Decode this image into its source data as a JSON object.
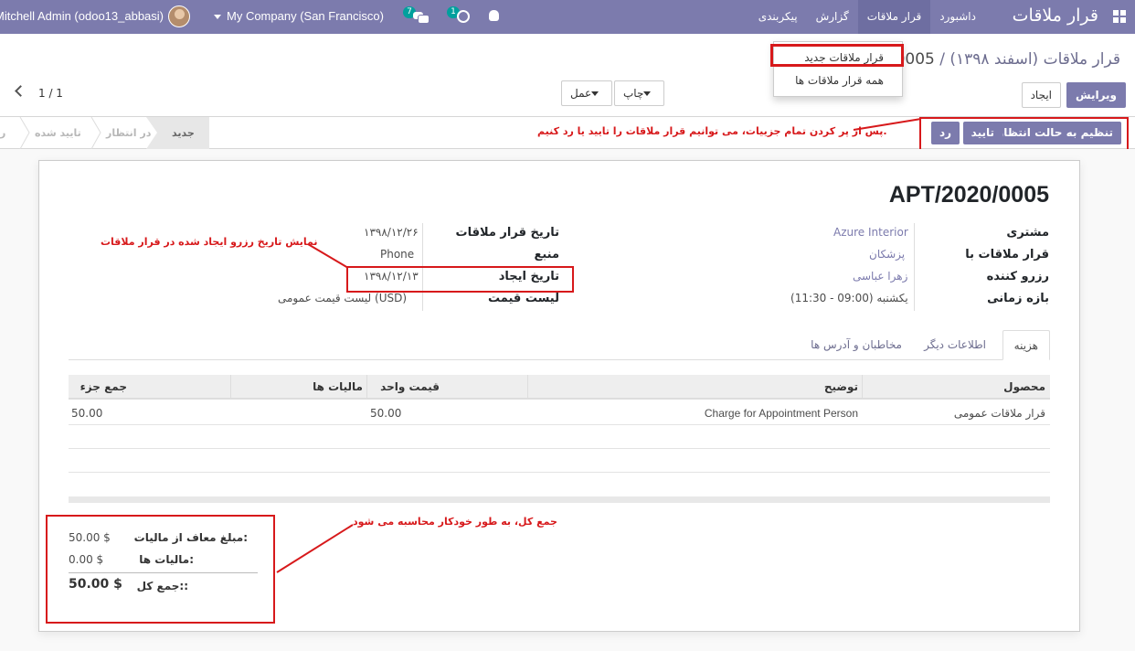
{
  "navbar": {
    "brand": "قرار ملاقات",
    "menu": [
      {
        "label": "داشبورد",
        "active": false
      },
      {
        "label": "قرار ملاقات",
        "active": true
      },
      {
        "label": "گزارش",
        "active": false
      },
      {
        "label": "پیکربندی",
        "active": false
      }
    ],
    "user": "Mitchell Admin (odoo13_abbasi)",
    "company": "My Company (San Francisco)",
    "chat_badge": "7",
    "activity_badge": "1",
    "color": "#7c7bad"
  },
  "dropdown": {
    "items": [
      "قرار ملاقات جدید",
      "همه قرار ملاقات ها"
    ]
  },
  "control": {
    "breadcrumb_parent": "قرار ملاقات (اسفند ۱۳۹۸) /",
    "breadcrumb_current": "0005",
    "edit": "ویرایش",
    "create": "ایجاد",
    "print": "چاپ",
    "action": "عمل",
    "pager": "1 / 1"
  },
  "statusbar": {
    "buttons": {
      "set_waiting": "تنظیم به حالت انتظار",
      "confirm": "تایید",
      "cancel": "رد"
    },
    "stages": [
      "جدید",
      "در انتظار",
      "تایید شده",
      "ر"
    ],
    "current_stage": "جدید"
  },
  "annotations": {
    "statusbar_note": "پس از پر کردن تمام جزییات، می توانیم قرار ملاقات را تایید یا رد کنیم.",
    "date_note": "نمایش تاریخ رزرو ایجاد شده در قرار ملاقات",
    "totals_note": "جمع کل، به طور خودکار محاسبه می شود",
    "color": "#d7191b"
  },
  "record": {
    "title": "APT/2020/0005",
    "left_fields": [
      {
        "label": "مشتری",
        "value": "Azure Interior",
        "link": true
      },
      {
        "label": "قرار ملاقات با",
        "value": "پزشکان",
        "link": true
      },
      {
        "label": "رزرو کننده",
        "value": "زهرا عباسی",
        "link": true
      },
      {
        "label": "بازه زمانی",
        "value": "یکشنبه (09:00 - 11:30)",
        "link": false
      }
    ],
    "right_fields": [
      {
        "label": "تاریخ قرار ملاقات",
        "value": "۱۳۹۸/۱۲/۲۶"
      },
      {
        "label": "منبع",
        "value": "Phone"
      },
      {
        "label": "تاریخ ایجاد",
        "value": "۱۳۹۸/۱۲/۱۳"
      },
      {
        "label": "لیست قیمت",
        "value": "لیست قیمت عمومی (USD)"
      }
    ]
  },
  "tabs": [
    {
      "label": "هزینه",
      "active": true
    },
    {
      "label": "اطلاعات دیگر",
      "active": false
    },
    {
      "label": "مخاطبان و آدرس ها",
      "active": false
    }
  ],
  "lines": {
    "headers": {
      "product": "محصول",
      "description": "توضیح",
      "unit_price": "قیمت واحد",
      "taxes": "مالیات ها",
      "subtotal": "جمع جزء"
    },
    "rows": [
      {
        "product": "قرار ملاقات عمومی",
        "description": "Charge for Appointment Person",
        "unit_price": "50.00",
        "taxes": "",
        "subtotal": "50.00"
      }
    ]
  },
  "totals": {
    "untaxed_label": "مبلغ معاف از مالیات:",
    "untaxed_value": "50.00 $",
    "taxes_label": "مالیات ها:",
    "taxes_value": "0.00 $",
    "total_label": "جمع کل::",
    "total_value": "50.00 $"
  }
}
